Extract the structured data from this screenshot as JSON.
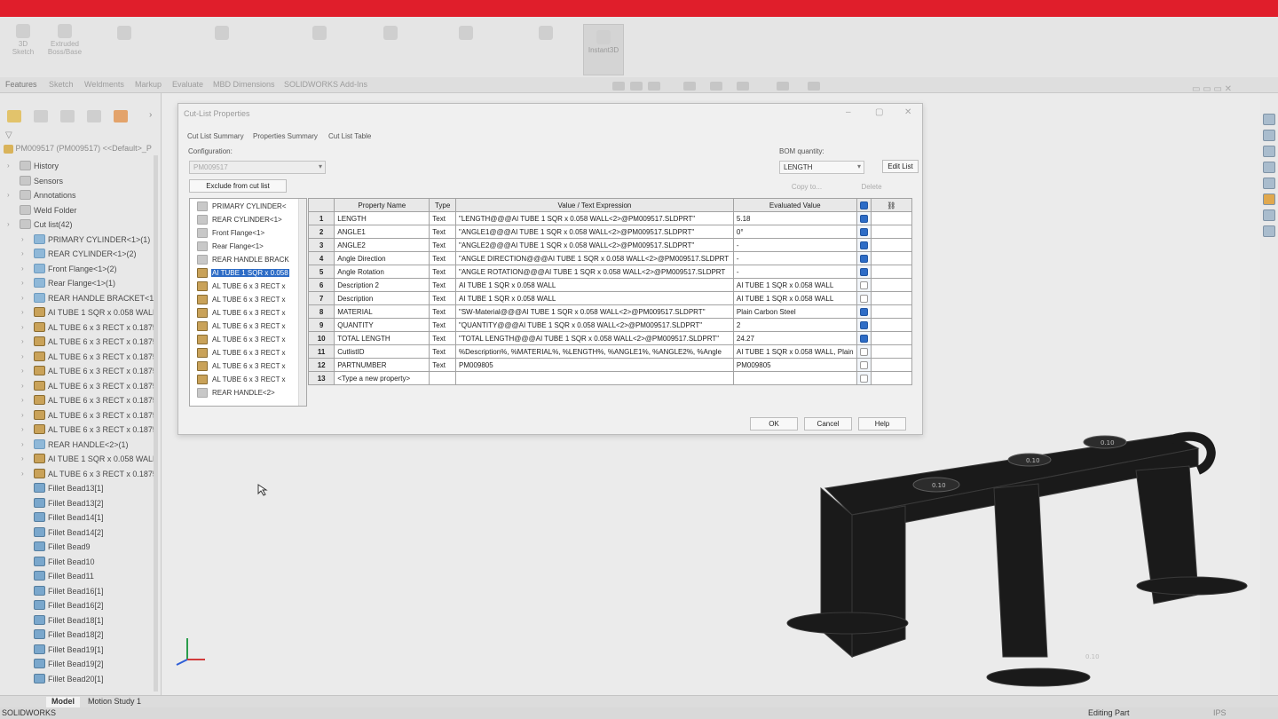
{
  "ribbon": {
    "groups": [
      "3D Sketch",
      "Extruded Boss/Base",
      "Instant3D"
    ],
    "instant3d_label": "Instant3D"
  },
  "command_tabs": [
    "Features",
    "Sketch",
    "Weldments",
    "Markup",
    "Evaluate",
    "MBD Dimensions",
    "SOLIDWORKS Add-Ins"
  ],
  "tree": {
    "root": "PM009517 (PM009517) <<Default>_P",
    "items": [
      {
        "label": "History",
        "icon": "history-icon",
        "exp": true
      },
      {
        "label": "Sensors",
        "icon": "sensor-icon",
        "exp": false
      },
      {
        "label": "Annotations",
        "icon": "annotations-icon",
        "exp": true
      },
      {
        "label": "Weld Folder",
        "icon": "weld-folder-icon",
        "exp": false
      },
      {
        "label": "Cut list(42)",
        "icon": "cut-list-icon",
        "exp": true
      },
      {
        "label": "PRIMARY CYLINDER<1>(1)",
        "icon": "folder-icon",
        "exp": true,
        "indent": 1
      },
      {
        "label": "REAR CYLINDER<1>(2)",
        "icon": "folder-icon",
        "exp": true,
        "indent": 1
      },
      {
        "label": "Front Flange<1>(2)",
        "icon": "folder-icon",
        "exp": true,
        "indent": 1
      },
      {
        "label": "Rear Flange<1>(1)",
        "icon": "folder-icon",
        "exp": true,
        "indent": 1
      },
      {
        "label": "REAR HANDLE BRACKET<1>",
        "icon": "folder-icon",
        "exp": true,
        "indent": 1
      },
      {
        "label": "AI TUBE 1 SQR x 0.058 WALL",
        "icon": "weldment-icon",
        "exp": true,
        "indent": 1
      },
      {
        "label": "AL TUBE 6 x 3 RECT x 0.1875",
        "icon": "weldment-icon",
        "exp": true,
        "indent": 1
      },
      {
        "label": "AL TUBE 6 x 3 RECT x 0.1875",
        "icon": "weldment-icon",
        "exp": true,
        "indent": 1
      },
      {
        "label": "AL TUBE 6 x 3 RECT x 0.1875",
        "icon": "weldment-icon",
        "exp": true,
        "indent": 1
      },
      {
        "label": "AL TUBE 6 x 3 RECT x 0.1875",
        "icon": "weldment-icon",
        "exp": true,
        "indent": 1
      },
      {
        "label": "AL TUBE 6 x 3 RECT x 0.1875",
        "icon": "weldment-icon",
        "exp": true,
        "indent": 1
      },
      {
        "label": "AL TUBE 6 x 3 RECT x 0.1875",
        "icon": "weldment-icon",
        "exp": true,
        "indent": 1
      },
      {
        "label": "AL TUBE 6 x 3 RECT x 0.1875",
        "icon": "weldment-icon",
        "exp": true,
        "indent": 1
      },
      {
        "label": "AL TUBE 6 x 3 RECT x 0.1875",
        "icon": "weldment-icon",
        "exp": true,
        "indent": 1
      },
      {
        "label": "REAR HANDLE<2>(1)",
        "icon": "folder-icon",
        "exp": true,
        "indent": 1
      },
      {
        "label": "AI TUBE 1 SQR x 0.058 WALL",
        "icon": "weldment-icon",
        "exp": true,
        "indent": 1
      },
      {
        "label": "AL TUBE 6 x 3 RECT x 0.1875",
        "icon": "weldment-icon",
        "exp": true,
        "indent": 1
      },
      {
        "label": "Fillet Bead13[1]",
        "icon": "fillet-bead-icon",
        "exp": false,
        "indent": 1
      },
      {
        "label": "Fillet Bead13[2]",
        "icon": "fillet-bead-icon",
        "exp": false,
        "indent": 1
      },
      {
        "label": "Fillet Bead14[1]",
        "icon": "fillet-bead-icon",
        "exp": false,
        "indent": 1
      },
      {
        "label": "Fillet Bead14[2]",
        "icon": "fillet-bead-icon",
        "exp": false,
        "indent": 1
      },
      {
        "label": "Fillet Bead9",
        "icon": "fillet-bead-icon",
        "exp": false,
        "indent": 1
      },
      {
        "label": "Fillet Bead10",
        "icon": "fillet-bead-icon",
        "exp": false,
        "indent": 1
      },
      {
        "label": "Fillet Bead11",
        "icon": "fillet-bead-icon",
        "exp": false,
        "indent": 1
      },
      {
        "label": "Fillet Bead16[1]",
        "icon": "fillet-bead-icon",
        "exp": false,
        "indent": 1
      },
      {
        "label": "Fillet Bead16[2]",
        "icon": "fillet-bead-icon",
        "exp": false,
        "indent": 1
      },
      {
        "label": "Fillet Bead18[1]",
        "icon": "fillet-bead-icon",
        "exp": false,
        "indent": 1
      },
      {
        "label": "Fillet Bead18[2]",
        "icon": "fillet-bead-icon",
        "exp": false,
        "indent": 1
      },
      {
        "label": "Fillet Bead19[1]",
        "icon": "fillet-bead-icon",
        "exp": false,
        "indent": 1
      },
      {
        "label": "Fillet Bead19[2]",
        "icon": "fillet-bead-icon",
        "exp": false,
        "indent": 1
      },
      {
        "label": "Fillet Bead20[1]",
        "icon": "fillet-bead-icon",
        "exp": false,
        "indent": 1
      }
    ]
  },
  "dialog": {
    "title": "Cut-List Properties",
    "tabs": [
      "Cut List Summary",
      "Properties Summary",
      "Cut List Table"
    ],
    "configuration_label": "Configuration:",
    "configuration_value": "PM009517",
    "exclude_button": "Exclude from cut list",
    "bom_label": "BOM quantity:",
    "bom_value": "LENGTH",
    "edit_list": "Edit List",
    "copy_to": "Copy to...",
    "delete": "Delete",
    "cut_list_items": [
      {
        "label": "PRIMARY CYLINDER<",
        "icon": "folder-icon"
      },
      {
        "label": "REAR CYLINDER<1>",
        "icon": "folder-icon"
      },
      {
        "label": "Front Flange<1>",
        "icon": "folder-icon"
      },
      {
        "label": "Rear Flange<1>",
        "icon": "folder-icon"
      },
      {
        "label": "REAR HANDLE BRACK",
        "icon": "folder-icon"
      },
      {
        "label": "AI TUBE 1 SQR x 0.058",
        "icon": "weldment-icon",
        "selected": true
      },
      {
        "label": "AL TUBE 6 x 3 RECT x",
        "icon": "weldment-icon"
      },
      {
        "label": "AL TUBE 6 x 3 RECT x",
        "icon": "weldment-icon"
      },
      {
        "label": "AL TUBE 6 x 3 RECT x",
        "icon": "weldment-icon"
      },
      {
        "label": "AL TUBE 6 x 3 RECT x",
        "icon": "weldment-icon"
      },
      {
        "label": "AL TUBE 6 x 3 RECT x",
        "icon": "weldment-icon"
      },
      {
        "label": "AL TUBE 6 x 3 RECT x",
        "icon": "weldment-icon"
      },
      {
        "label": "AL TUBE 6 x 3 RECT x",
        "icon": "weldment-icon"
      },
      {
        "label": "AL TUBE 6 x 3 RECT x",
        "icon": "weldment-icon"
      },
      {
        "label": "REAR HANDLE<2>",
        "icon": "folder-icon"
      }
    ],
    "columns": [
      "Property Name",
      "Type",
      "Value / Text Expression",
      "Evaluated Value"
    ],
    "rows": [
      {
        "num": "1",
        "name": "LENGTH",
        "type": "Text",
        "expr": "\"LENGTH@@@AI TUBE 1 SQR x 0.058 WALL<2>@PM009517.SLDPRT\"",
        "value": "5.18",
        "checked": true
      },
      {
        "num": "2",
        "name": "ANGLE1",
        "type": "Text",
        "expr": "\"ANGLE1@@@AI TUBE 1 SQR x 0.058 WALL<2>@PM009517.SLDPRT\"",
        "value": "0°",
        "checked": true
      },
      {
        "num": "3",
        "name": "ANGLE2",
        "type": "Text",
        "expr": "\"ANGLE2@@@AI TUBE 1 SQR x 0.058 WALL<2>@PM009517.SLDPRT\"",
        "value": "-",
        "checked": true
      },
      {
        "num": "4",
        "name": "Angle Direction",
        "type": "Text",
        "expr": "\"ANGLE DIRECTION@@@AI TUBE 1 SQR x 0.058 WALL<2>@PM009517.SLDPRT",
        "value": "-",
        "checked": true
      },
      {
        "num": "5",
        "name": "Angle Rotation",
        "type": "Text",
        "expr": "\"ANGLE ROTATION@@@AI TUBE 1 SQR x 0.058 WALL<2>@PM009517.SLDPRT",
        "value": "-",
        "checked": true
      },
      {
        "num": "6",
        "name": "Description 2",
        "type": "Text",
        "expr": "AI TUBE 1 SQR x 0.058 WALL",
        "value": "AI TUBE 1 SQR x 0.058 WALL",
        "checked": false
      },
      {
        "num": "7",
        "name": "Description",
        "type": "Text",
        "expr": "AI TUBE 1 SQR x 0.058 WALL",
        "value": "AI TUBE 1 SQR x 0.058 WALL",
        "checked": false
      },
      {
        "num": "8",
        "name": "MATERIAL",
        "type": "Text",
        "expr": "\"SW-Material@@@AI TUBE 1 SQR x 0.058 WALL<2>@PM009517.SLDPRT\"",
        "value": "Plain Carbon Steel",
        "checked": true
      },
      {
        "num": "9",
        "name": "QUANTITY",
        "type": "Text",
        "expr": "\"QUANTITY@@@AI TUBE 1 SQR x 0.058 WALL<2>@PM009517.SLDPRT\"",
        "value": "2",
        "checked": true
      },
      {
        "num": "10",
        "name": "TOTAL LENGTH",
        "type": "Text",
        "expr": "\"TOTAL LENGTH@@@AI TUBE 1 SQR x 0.058 WALL<2>@PM009517.SLDPRT\"",
        "value": "24.27",
        "checked": true
      },
      {
        "num": "11",
        "name": "CutlistID",
        "type": "Text",
        "expr": "%Description%, %MATERIAL%, %LENGTH%, %ANGLE1%, %ANGLE2%, %Angle",
        "value": "AI TUBE 1 SQR x 0.058 WALL, Plain",
        "checked": false
      },
      {
        "num": "12",
        "name": "PARTNUMBER",
        "type": "Text",
        "expr": "PM009805",
        "value": "PM009805",
        "checked": false
      },
      {
        "num": "13",
        "name": "<Type a new property>",
        "type": "",
        "expr": "",
        "value": "",
        "checked": false
      }
    ],
    "ok": "OK",
    "cancel": "Cancel",
    "help": "Help"
  },
  "bottom_tabs": [
    "Model",
    "Motion Study 1"
  ],
  "status": {
    "app": "SOLIDWORKS",
    "mode": "Editing Part",
    "units": "IPS"
  },
  "model_labels": [
    "0.10",
    "0.10",
    "0.10",
    "0.10"
  ]
}
